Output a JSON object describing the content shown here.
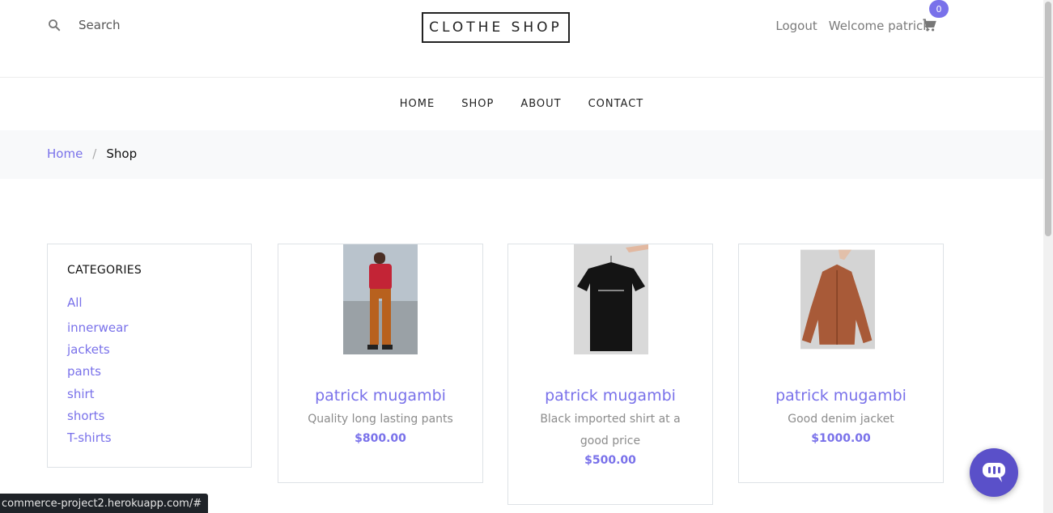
{
  "header": {
    "search_label": "Search",
    "logo": "CLOTHE SHOP",
    "logout": "Logout",
    "welcome": "Welcome patrick",
    "cart_count": "0"
  },
  "nav": {
    "items": [
      "HOME",
      "SHOP",
      "ABOUT",
      "CONTACT"
    ]
  },
  "breadcrumb": {
    "home": "Home",
    "separator": "/",
    "current": "Shop"
  },
  "sidebar": {
    "title": "CATEGORIES",
    "categories": [
      "All",
      "innerwear",
      "jackets",
      "pants",
      "shirt",
      "shorts",
      "T-shirts"
    ]
  },
  "products": [
    {
      "name": "patrick mugambi",
      "description": "Quality long lasting pants",
      "price": "$800.00",
      "image": "woman-in-red-top-orange-pants"
    },
    {
      "name": "patrick mugambi",
      "description": "Black imported shirt at a good price",
      "price": "$500.00",
      "image": "black-tshirt-on-hanger"
    },
    {
      "name": "patrick mugambi",
      "description": "Good denim jacket",
      "price": "$1000.00",
      "image": "rust-jacket-on-hanger"
    }
  ],
  "status_bar": {
    "url": "commerce-project2.herokuapp.com/#"
  },
  "colors": {
    "accent": "#7971ea",
    "chat": "#5a50c9",
    "breadcrumb_bg": "#f8f9fa"
  }
}
